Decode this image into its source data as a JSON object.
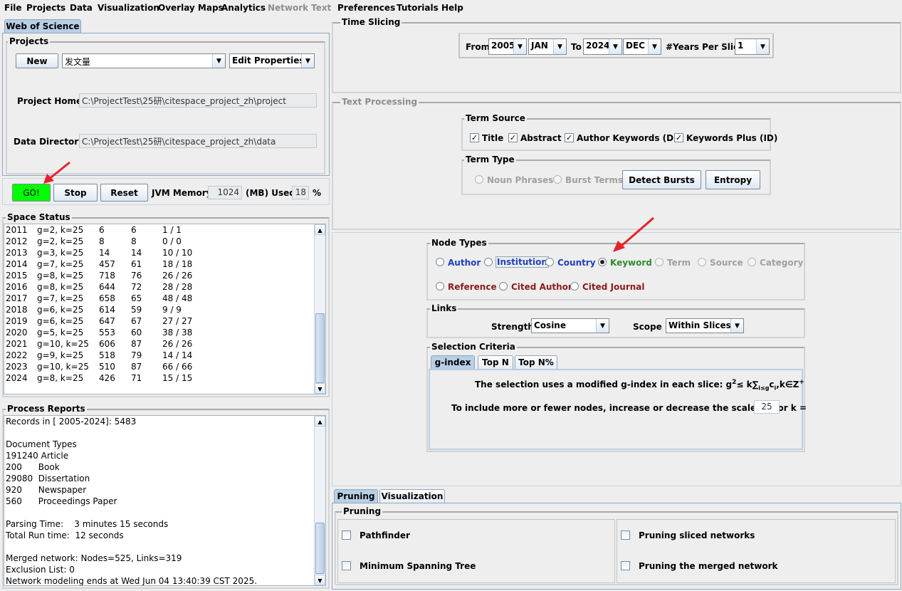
{
  "menu": [
    "File",
    "Projects",
    "Data",
    "Visualization",
    "Overlay Maps",
    "Analytics",
    "Network",
    "Text",
    "Preferences",
    "Tutorials",
    "Help"
  ],
  "menu_disabled": [
    "Network",
    "Text"
  ],
  "left": {
    "top_tab": "Web of Science",
    "projects_title": "Projects",
    "new_button": "New",
    "project_name": "发文量",
    "edit_properties": "Edit Properties",
    "project_home_label": "Project Home:",
    "project_home_value": "C:\\ProjectTest\\25研\\citespace_project_zh\\project",
    "data_dir_label": "Data Directory:",
    "data_dir_value": "C:\\ProjectTest\\25研\\citespace_project_zh\\data",
    "go_button": "GO!",
    "stop_button": "Stop",
    "reset_button": "Reset",
    "jvm_label": "JVM Memory",
    "jvm_value": "1024",
    "mb_used_label": "(MB) Used",
    "used_value": "18",
    "percent": "%",
    "go_color": "#00ff00",
    "space_status_title": "Space Status",
    "space_status_rows": [
      [
        "2011",
        "g=2, k=25",
        "6",
        "6",
        "1 / 1"
      ],
      [
        "2012",
        "g=2, k=25",
        "8",
        "8",
        "0 / 0"
      ],
      [
        "2013",
        "g=3, k=25",
        "14",
        "14",
        "10 / 10"
      ],
      [
        "2014",
        "g=7, k=25",
        "457",
        "61",
        "18 / 18"
      ],
      [
        "2015",
        "g=8, k=25",
        "718",
        "76",
        "26 / 26"
      ],
      [
        "2016",
        "g=8, k=25",
        "644",
        "72",
        "28 / 28"
      ],
      [
        "2017",
        "g=7, k=25",
        "658",
        "65",
        "48 / 48"
      ],
      [
        "2018",
        "g=6, k=25",
        "614",
        "59",
        "9 / 9"
      ],
      [
        "2019",
        "g=6, k=25",
        "647",
        "67",
        "27 / 27"
      ],
      [
        "2020",
        "g=5, k=25",
        "553",
        "60",
        "38 / 38"
      ],
      [
        "2021",
        "g=10, k=25",
        "606",
        "87",
        "26 / 26"
      ],
      [
        "2022",
        "g=9, k=25",
        "518",
        "79",
        "14 / 14"
      ],
      [
        "2023",
        "g=10, k=25",
        "510",
        "87",
        "66 / 66"
      ],
      [
        "2024",
        "g=8, k=25",
        "426",
        "71",
        "15 / 15"
      ]
    ],
    "process_reports_title": "Process Reports",
    "process_lines": [
      "Records in [ 2005-2024]: 5483",
      "",
      "Document Types",
      "191240 Article",
      "200      Book",
      "29080  Dissertation",
      "920      Newspaper",
      "560      Proceedings Paper",
      "",
      "Parsing Time:    3 minutes 15 seconds",
      "Total Run time:  12 seconds",
      "",
      "Merged network: Nodes=525, Links=319",
      "Exclusion List: 0",
      "Network modeling ends at Wed Jun 04 13:40:39 CST 2025."
    ]
  },
  "time_slicing": {
    "title": "Time Slicing",
    "from_label": "From",
    "from_year": "2005",
    "from_month": "JAN",
    "to_label": "To",
    "to_year": "2024",
    "to_month": "DEC",
    "years_per_slice_label": "#Years Per Slice",
    "years_per_slice": "1"
  },
  "text_processing": {
    "title": "Text Processing",
    "term_source_title": "Term Source",
    "term_sources": [
      {
        "label": "Title",
        "checked": true
      },
      {
        "label": "Abstract",
        "checked": true
      },
      {
        "label": "Author Keywords (DE)",
        "checked": true
      },
      {
        "label": "Keywords Plus (ID)",
        "checked": true
      }
    ],
    "term_type_title": "Term Type",
    "noun_phrases": "Noun Phrases",
    "burst_terms": "Burst Terms",
    "detect_bursts": "Detect Bursts",
    "entropy": "Entropy"
  },
  "node_types": {
    "title": "Node Types",
    "row1": [
      {
        "label": "Author",
        "color": "#1f3fbf",
        "selected": false,
        "enabled": true
      },
      {
        "label": "Institution",
        "color": "#1f3fbf",
        "selected": false,
        "enabled": true
      },
      {
        "label": "Country",
        "color": "#1f3fbf",
        "selected": false,
        "enabled": true
      },
      {
        "label": "Keyword",
        "color": "#2e8b2e",
        "selected": true,
        "enabled": true
      },
      {
        "label": "Term",
        "color": "#a0a0a0",
        "selected": false,
        "enabled": false
      },
      {
        "label": "Source",
        "color": "#a0a0a0",
        "selected": false,
        "enabled": false
      },
      {
        "label": "Category",
        "color": "#a0a0a0",
        "selected": false,
        "enabled": false
      }
    ],
    "row2": [
      {
        "label": "Reference",
        "color": "#8b1a1a"
      },
      {
        "label": "Cited Author",
        "color": "#8b1a1a"
      },
      {
        "label": "Cited Journal",
        "color": "#8b1a1a"
      }
    ]
  },
  "links": {
    "title": "Links",
    "strength_label": "Strength",
    "strength_value": "Cosine",
    "scope_label": "Scope",
    "scope_value": "Within Slices"
  },
  "selection": {
    "title": "Selection Criteria",
    "tabs": [
      "g-index",
      "Top N",
      "Top N%"
    ],
    "formula_text": "The selection uses a modified g-index in each slice: g",
    "formula_tail": "≤ k∑",
    "formula_sub": "i≤g",
    "formula_c": "c",
    "formula_ci": "i",
    "formula_end": ",k∈Z",
    "formula_plus": "+",
    "formula_sup2": "2",
    "scale_text": "To include more or fewer nodes, increase or decrease the scale factor k =",
    "scale_value": "25"
  },
  "bottom_tabs": [
    "Pruning",
    "Visualization"
  ],
  "pruning": {
    "title": "Pruning",
    "pathfinder": "Pathfinder",
    "mst": "Minimum Spanning Tree",
    "pruning_sliced": "Pruning sliced networks",
    "pruning_merged": "Pruning the merged network"
  }
}
